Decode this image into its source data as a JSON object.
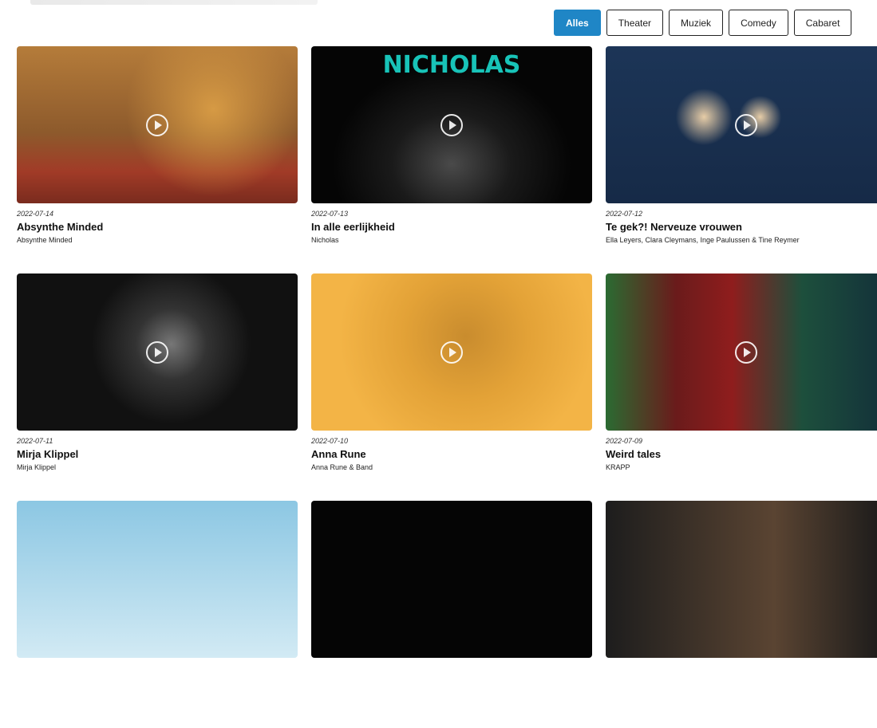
{
  "filters": [
    {
      "label": "Alles",
      "active": true
    },
    {
      "label": "Theater",
      "active": false
    },
    {
      "label": "Muziek",
      "active": false
    },
    {
      "label": "Comedy",
      "active": false
    },
    {
      "label": "Cabaret",
      "active": false
    }
  ],
  "cards": [
    {
      "date": "2022-07-14",
      "title": "Absynthe Minded",
      "subtitle": "Absynthe Minded"
    },
    {
      "date": "2022-07-13",
      "title": "In alle eerlijkheid",
      "subtitle": "Nicholas",
      "thumb_text": "NICHOLAS"
    },
    {
      "date": "2022-07-12",
      "title": "Te gek?! Nerveuze vrouwen",
      "subtitle": "Ella Leyers, Clara Cleymans, Inge Paulussen & Tine Reymer"
    },
    {
      "date": "2022-07-11",
      "title": "Mirja Klippel",
      "subtitle": "Mirja Klippel"
    },
    {
      "date": "2022-07-10",
      "title": "Anna Rune",
      "subtitle": "Anna Rune & Band"
    },
    {
      "date": "2022-07-09",
      "title": "Weird tales",
      "subtitle": "KRAPP"
    }
  ],
  "colors": {
    "accent": "#1f86c6",
    "nicholas_text": "#18c3b8"
  },
  "icons": {
    "play": "play-circle-icon"
  }
}
